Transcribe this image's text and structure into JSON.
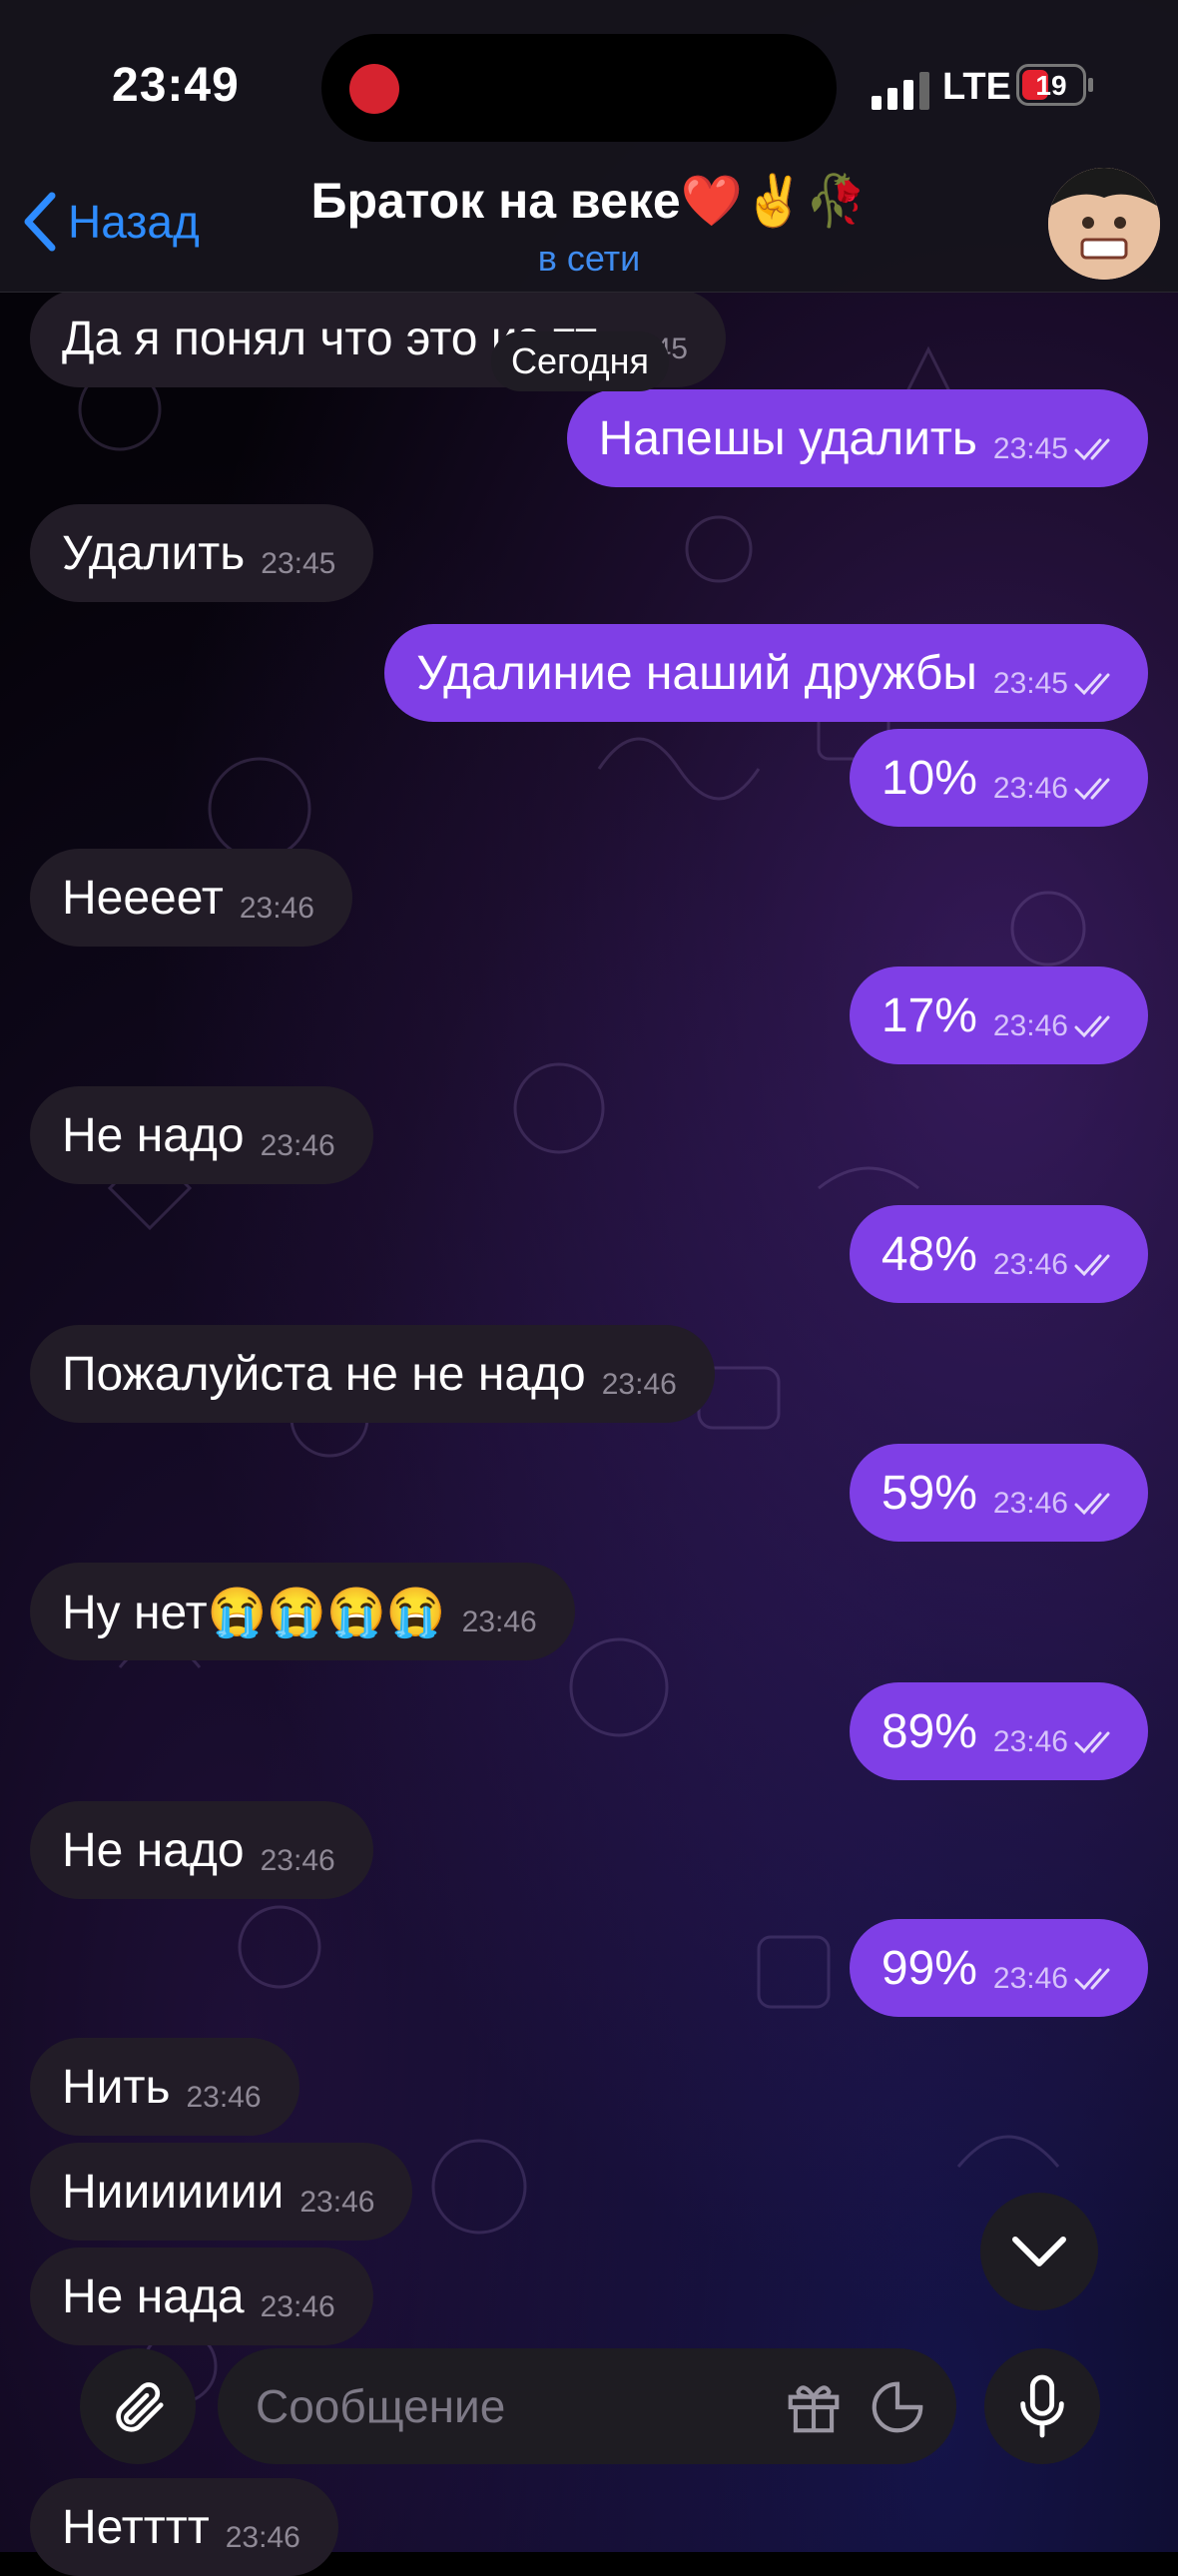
{
  "status_bar": {
    "time": "23:49",
    "network": "LTE",
    "battery": "19"
  },
  "header": {
    "back_label": "Назад",
    "title": "Браток на веке❤️✌️🥀",
    "subtitle": "в сети"
  },
  "date_separator": "Сегодня",
  "messages": [
    {
      "dir": "in",
      "text": "Да я понял что это из тт",
      "time": "23:45"
    },
    {
      "dir": "out",
      "text": "Напешы удалить",
      "time": "23:45"
    },
    {
      "dir": "in",
      "text": "Удалить",
      "time": "23:45"
    },
    {
      "dir": "out",
      "text": "Удалиние наший дружбы",
      "time": "23:45"
    },
    {
      "dir": "out",
      "text": "10%",
      "time": "23:46"
    },
    {
      "dir": "in",
      "text": "Неееет",
      "time": "23:46"
    },
    {
      "dir": "out",
      "text": "17%",
      "time": "23:46"
    },
    {
      "dir": "in",
      "text": "Не надо",
      "time": "23:46"
    },
    {
      "dir": "out",
      "text": "48%",
      "time": "23:46"
    },
    {
      "dir": "in",
      "text": "Пожалуйста не не надо",
      "time": "23:46"
    },
    {
      "dir": "out",
      "text": "59%",
      "time": "23:46"
    },
    {
      "dir": "in",
      "text": "Ну нет😭😭😭😭",
      "time": "23:46"
    },
    {
      "dir": "out",
      "text": "89%",
      "time": "23:46"
    },
    {
      "dir": "in",
      "text": "Не надо",
      "time": "23:46"
    },
    {
      "dir": "out",
      "text": "99%",
      "time": "23:46"
    },
    {
      "dir": "in",
      "text": "Нить",
      "time": "23:46"
    },
    {
      "dir": "in",
      "text": "Ниииииии",
      "time": "23:46"
    },
    {
      "dir": "in",
      "text": "Не нада",
      "time": "23:46"
    },
    {
      "dir": "in",
      "text": "Нетттт",
      "time": "23:46"
    }
  ],
  "composer": {
    "placeholder": "Сообщение"
  },
  "colors": {
    "accent": "#2e8cff",
    "outgoing": "#7f3fe6",
    "incoming": "#221c27",
    "online": "#3f8cf0"
  }
}
